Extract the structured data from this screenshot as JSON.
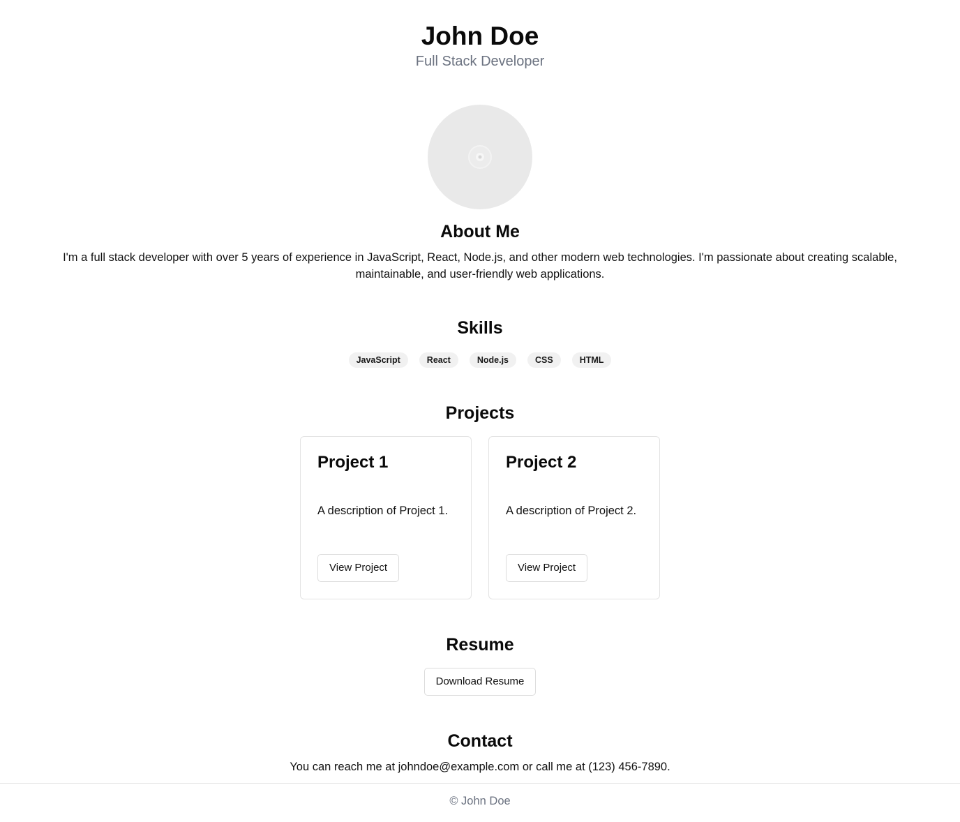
{
  "header": {
    "name": "John Doe",
    "role": "Full Stack Developer"
  },
  "avatar": {
    "icon": "image-placeholder-icon"
  },
  "about": {
    "title": "About Me",
    "text": "I'm a full stack developer with over 5 years of experience in JavaScript, React, Node.js, and other modern web technologies. I'm passionate about creating scalable, maintainable, and user-friendly web applications."
  },
  "skills": {
    "title": "Skills",
    "items": [
      "JavaScript",
      "React",
      "Node.js",
      "CSS",
      "HTML"
    ]
  },
  "projects": {
    "title": "Projects",
    "items": [
      {
        "title": "Project 1",
        "description": "A description of Project 1.",
        "button": "View Project"
      },
      {
        "title": "Project 2",
        "description": "A description of Project 2.",
        "button": "View Project"
      }
    ]
  },
  "resume": {
    "title": "Resume",
    "button": "Download Resume"
  },
  "contact": {
    "title": "Contact",
    "text": "You can reach me at johndoe@example.com or call me at (123) 456-7890."
  },
  "footer": {
    "text": "© John Doe"
  },
  "colors": {
    "background": "#ffffff",
    "muted_text": "#6b7280",
    "avatar_bg": "#e9e9e9",
    "chip_bg": "#f1f1f1",
    "border": "#e3e3e3"
  }
}
